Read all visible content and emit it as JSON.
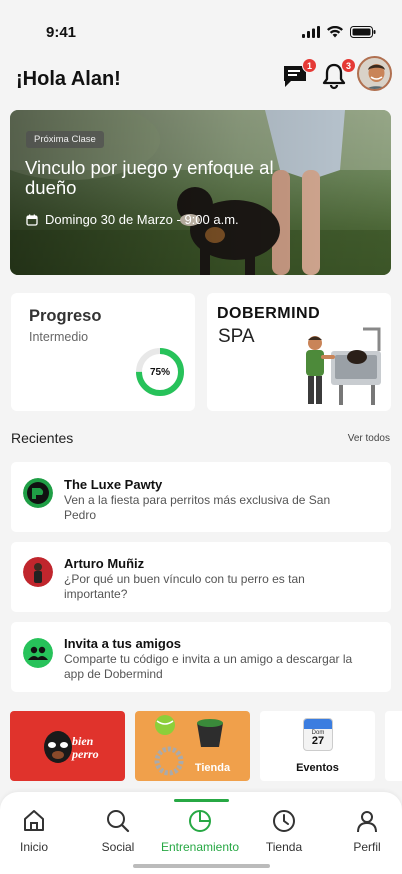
{
  "status": {
    "time": "9:41"
  },
  "header": {
    "greeting": "¡Hola Alan!",
    "messages_badge": "1",
    "notifications_badge": "3"
  },
  "hero": {
    "tag": "Próxima Clase",
    "title": "Vinculo por juego y enfoque al dueño",
    "date": "Domingo 30 de Marzo - 9:00 a.m."
  },
  "progress": {
    "title": "Progreso",
    "level": "Intermedio",
    "percent_label": "75%",
    "percent": 75
  },
  "spa": {
    "brand": "DOBERMIND",
    "sub": "SPA"
  },
  "recent": {
    "title": "Recientes",
    "see_all": "Ver todos",
    "items": [
      {
        "title": "The Luxe Pawty",
        "desc": "Ven a la fiesta para perritos más exclusiva de San Pedro"
      },
      {
        "title": "Arturo Muñiz",
        "desc": "¿Por qué un buen vínculo con tu perro es tan importante?"
      },
      {
        "title": "Invita a tus amigos",
        "desc": "Comparte tu código e invita a un amigo a descargar la app de Dobermind"
      }
    ]
  },
  "promos": {
    "bien_perro": "bien perro",
    "tienda": "Tienda",
    "calendar_day_label": "Dom",
    "calendar_day": "27",
    "eventos": "Eventos"
  },
  "tabs": [
    {
      "label": "Inicio"
    },
    {
      "label": "Social"
    },
    {
      "label": "Entrenamiento"
    },
    {
      "label": "Tienda"
    },
    {
      "label": "Perfil"
    }
  ],
  "colors": {
    "accent": "#27a844",
    "badge": "#e53935",
    "promo_red": "#e0332c",
    "promo_orange": "#f0a04b"
  }
}
